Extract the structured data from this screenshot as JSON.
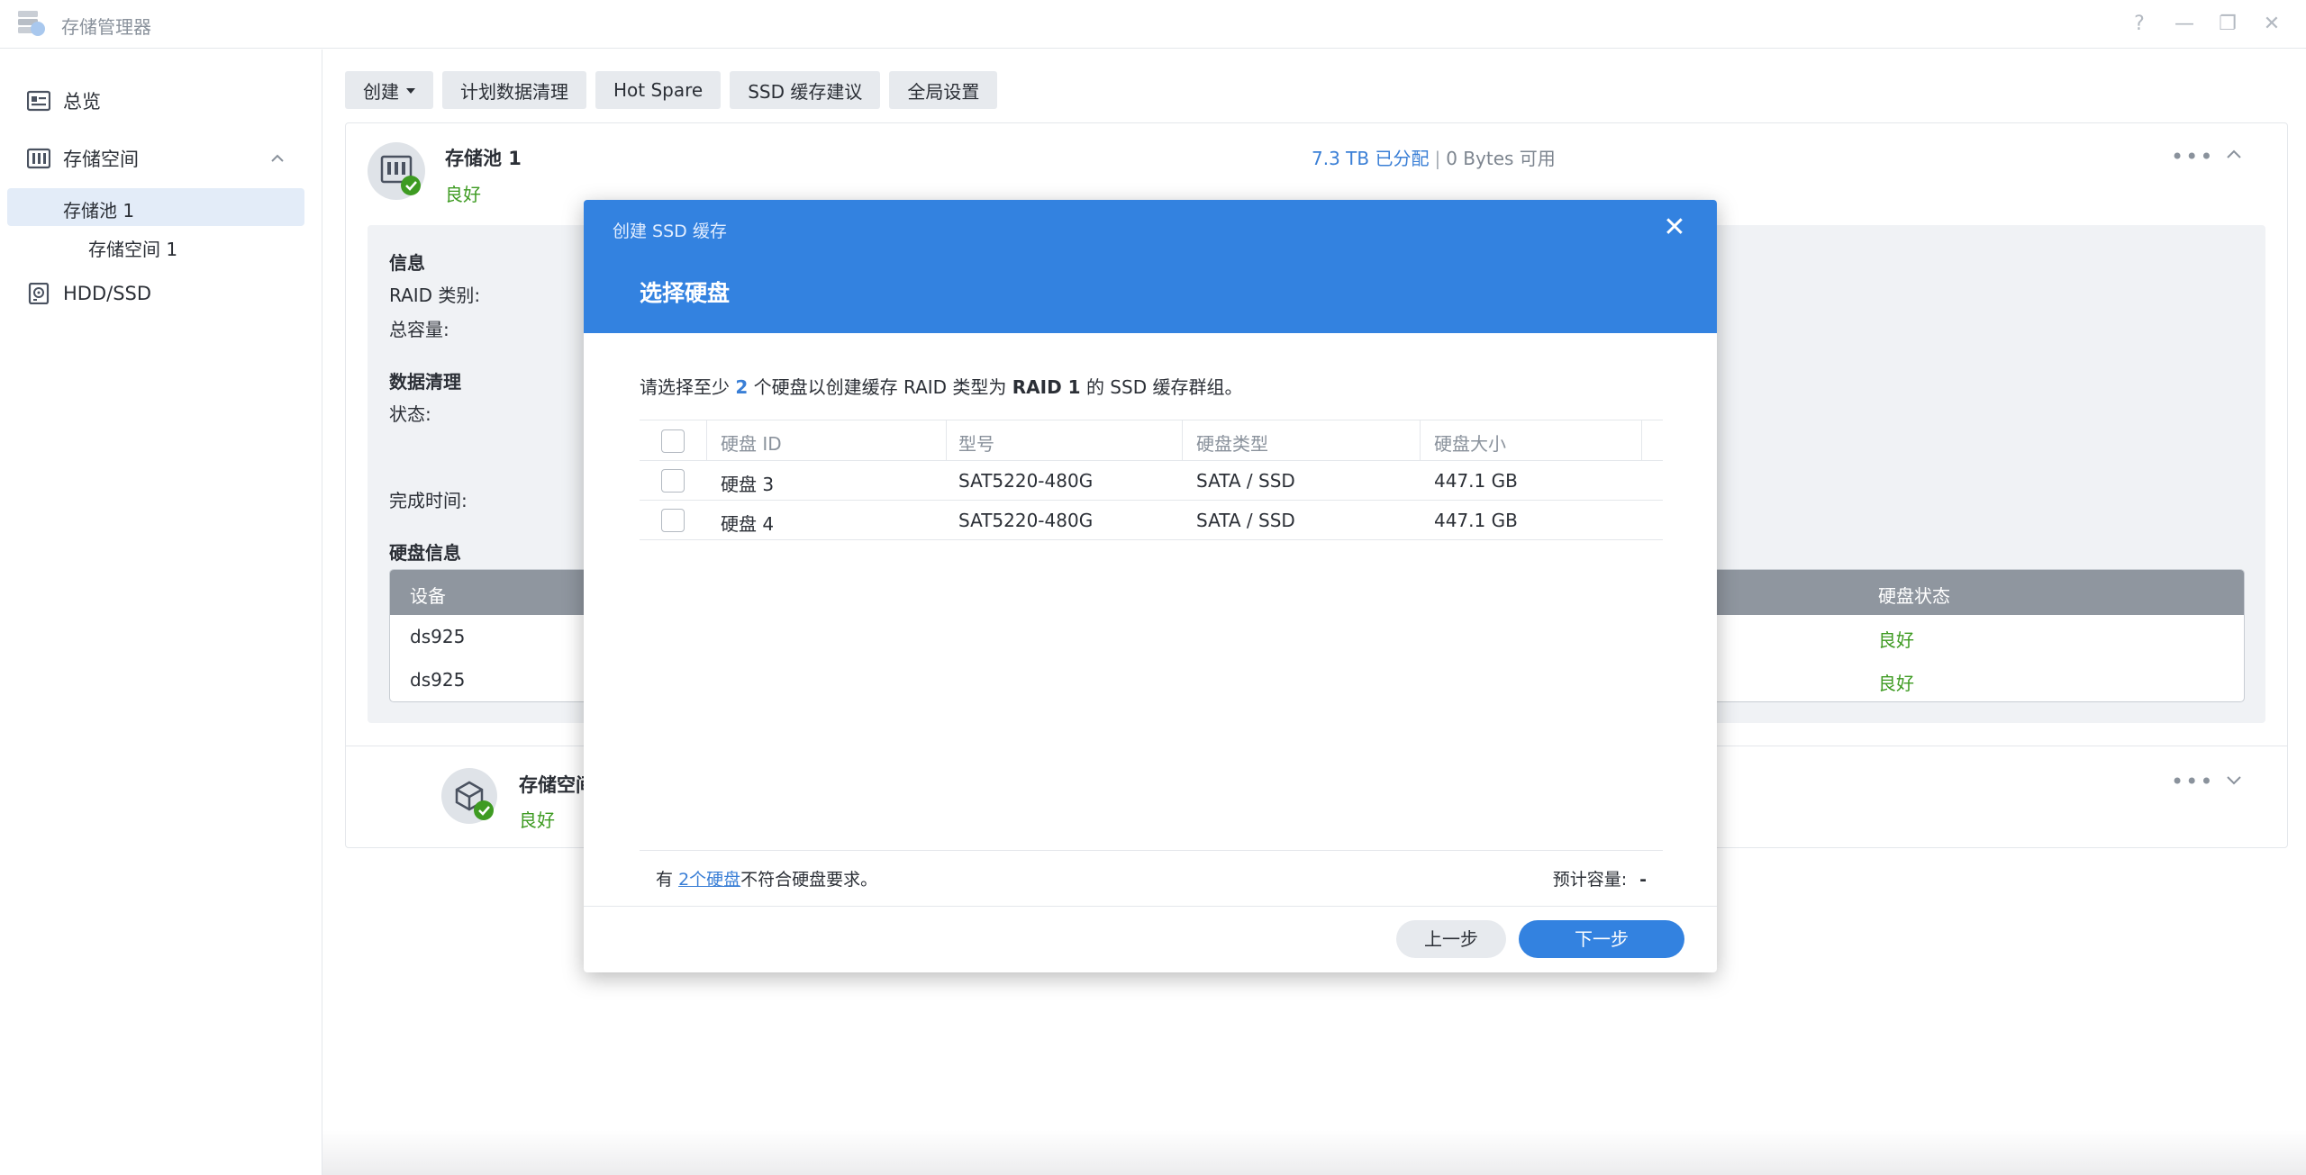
{
  "window": {
    "title": "存储管理器",
    "controls": [
      "?",
      "—",
      "❐",
      "✕"
    ]
  },
  "sidebar": {
    "overview": "总览",
    "storage": "存储空间",
    "pool": "存储池 1",
    "volume": "存储空间 1",
    "hdd": "HDD/SSD"
  },
  "toolbar": {
    "create": "创建",
    "scrub": "计划数据清理",
    "hot_spare": "Hot Spare",
    "ssd_advice": "SSD 缓存建议",
    "global": "全局设置"
  },
  "pool": {
    "name": "存储池 1",
    "status": "良好",
    "allocated": "7.3 TB 已分配",
    "separator": "|",
    "available": "0 Bytes 可用",
    "info_title": "信息",
    "raid_label": "RAID 类别:",
    "capacity_label": "总容量:",
    "scrub_title": "数据清理",
    "state_label": "状态:",
    "finish_label": "完成时间:",
    "disk_info_title": "硬盘信息",
    "disk_table": {
      "col_device": "设备",
      "col_status": "硬盘状态",
      "rows": [
        {
          "device": "ds925",
          "status": "良好"
        },
        {
          "device": "ds925",
          "status": "良好"
        }
      ]
    }
  },
  "volume": {
    "name": "存储空间",
    "status": "良好"
  },
  "modal": {
    "subtitle": "创建 SSD 缓存",
    "title": "选择硬盘",
    "desc_prefix": "请选择至少",
    "desc_num": "2",
    "desc_mid": "个硬盘以创建缓存 RAID 类型为",
    "desc_raid": "RAID 1",
    "desc_suffix": "的 SSD 缓存群组。",
    "columns": [
      "硬盘 ID",
      "型号",
      "硬盘类型",
      "硬盘大小"
    ],
    "rows": [
      {
        "id": "硬盘 3",
        "model": "SAT5220-480G",
        "type": "SATA / SSD",
        "size": "447.1 GB"
      },
      {
        "id": "硬盘 4",
        "model": "SAT5220-480G",
        "type": "SATA / SSD",
        "size": "447.1 GB"
      }
    ],
    "notice_prefix": "有",
    "notice_link": "2个硬盘",
    "notice_suffix": "不符合硬盘要求。",
    "est_label": "预计容量:",
    "est_value": "-",
    "prev": "上一步",
    "next": "下一步"
  }
}
